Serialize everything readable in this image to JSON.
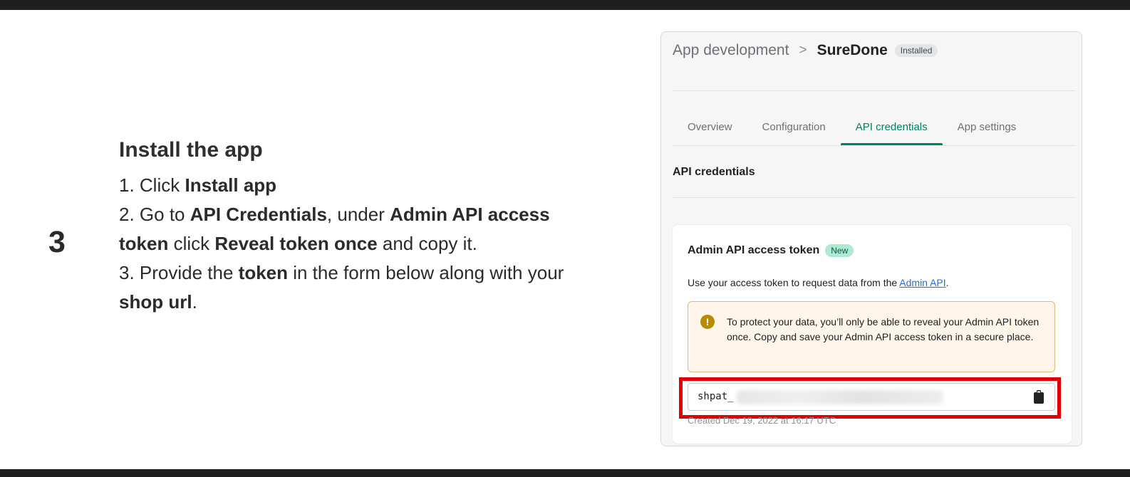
{
  "step": {
    "number": "3",
    "title": "Install the app",
    "lines": [
      [
        {
          "t": "1. Click ",
          "b": false
        },
        {
          "t": "Install app",
          "b": true
        }
      ],
      [
        {
          "t": "2. Go to ",
          "b": false
        },
        {
          "t": "API Credentials",
          "b": true
        },
        {
          "t": ", under ",
          "b": false
        },
        {
          "t": "Admin API access",
          "b": true
        }
      ],
      [
        {
          "t": "token",
          "b": true
        },
        {
          "t": " click ",
          "b": false
        },
        {
          "t": "Reveal token once",
          "b": true
        },
        {
          "t": " and copy it.",
          "b": false
        }
      ],
      [
        {
          "t": "3. Provide the ",
          "b": false
        },
        {
          "t": "token",
          "b": true
        },
        {
          "t": " in the form below along with your",
          "b": false
        }
      ],
      [
        {
          "t": "shop url",
          "b": true
        },
        {
          "t": ".",
          "b": false
        }
      ]
    ]
  },
  "panel": {
    "breadcrumb_parent": "App development",
    "breadcrumb_separator": ">",
    "breadcrumb_current": "SureDone",
    "status_badge": "Installed",
    "tabs": [
      "Overview",
      "Configuration",
      "API credentials",
      "App settings"
    ],
    "active_tab": 2,
    "section_title": "API credentials",
    "card": {
      "title": "Admin API access token",
      "new_badge": "New",
      "desc_prefix": "Use your access token to request data from the ",
      "desc_link": "Admin API",
      "desc_suffix": ".",
      "warning": "To protect your data, you’ll only be able to reveal your Admin API token once. Copy and save your Admin API access token in a secure place.",
      "token_prefix": "shpat_",
      "created": "Created Dec 19, 2022 at 16:17 UTC"
    }
  },
  "colors": {
    "accent_green": "#008060",
    "highlight_red": "#e00000",
    "warning_bg": "#fff5ea",
    "link_blue": "#2c6ecb"
  },
  "icons": {
    "warning": "exclamation-circle-icon",
    "copy": "clipboard-icon"
  }
}
